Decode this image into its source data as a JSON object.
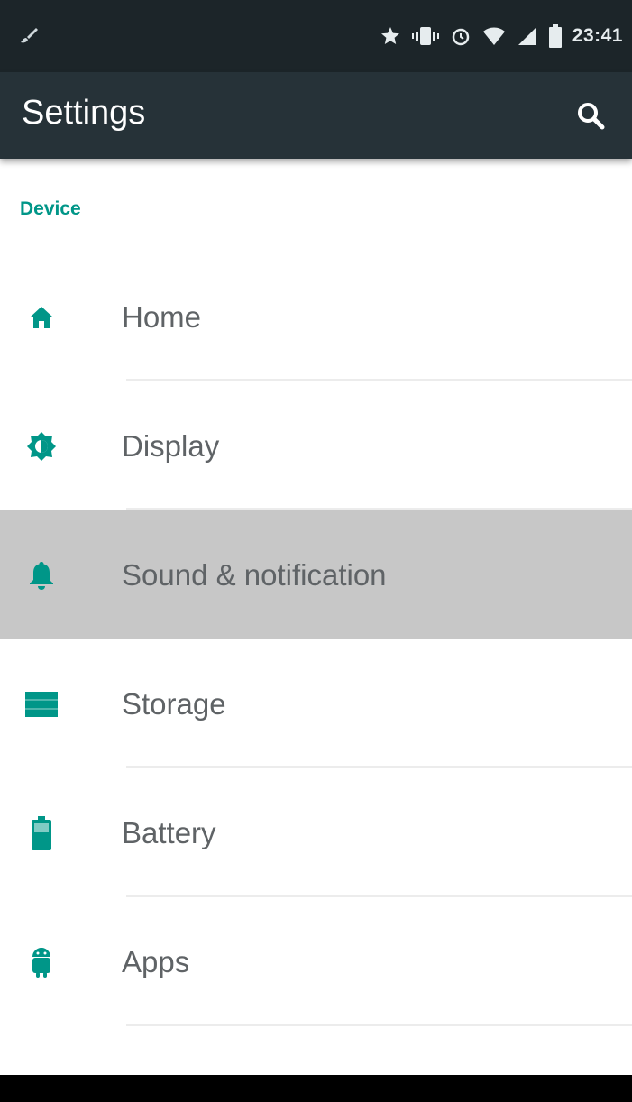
{
  "status_bar": {
    "time": "23:41",
    "icons": [
      "paint-brush-icon",
      "star-icon",
      "vibrate-icon",
      "alarm-icon",
      "wifi-icon",
      "signal-icon",
      "battery-icon"
    ]
  },
  "toolbar": {
    "title": "Settings",
    "search_icon": "search-icon"
  },
  "section": {
    "header": "Device"
  },
  "items": [
    {
      "label": "Home",
      "icon": "home-icon"
    },
    {
      "label": "Display",
      "icon": "brightness-icon"
    },
    {
      "label": "Sound & notification",
      "icon": "bell-icon",
      "active": true
    },
    {
      "label": "Storage",
      "icon": "storage-icon"
    },
    {
      "label": "Battery",
      "icon": "battery-icon"
    },
    {
      "label": "Apps",
      "icon": "android-icon"
    }
  ],
  "colors": {
    "status_bar": "#1c2529",
    "toolbar": "#263238",
    "accent": "#009688",
    "active_row": "#c7c7c7",
    "item_text": "#5f6366"
  }
}
